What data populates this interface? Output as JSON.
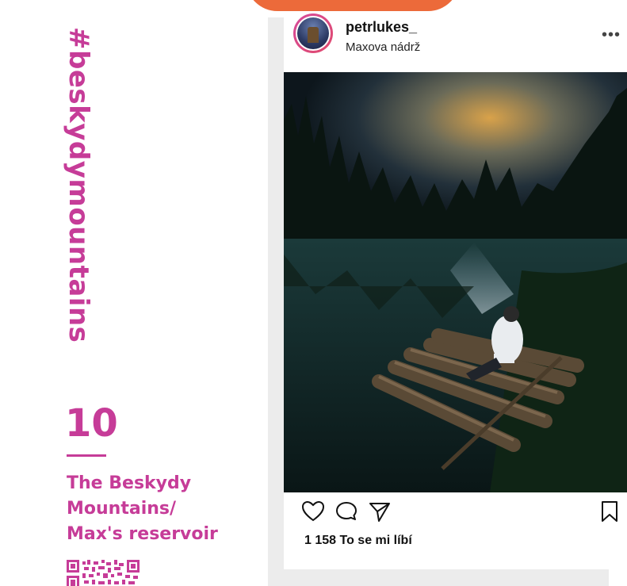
{
  "left_panel": {
    "hashtag": "#beskydymountains",
    "number": "10",
    "title_line1": "The Beskydy",
    "title_line2": "Mountains/",
    "title_line3": "Max's reservoir"
  },
  "post": {
    "username": "petrlukes_",
    "location": "Maxova nádrž",
    "more_label": "•••",
    "likes": "1 158 To se mi líbí"
  },
  "icons": {
    "like": "heart-icon",
    "comment": "comment-icon",
    "share": "send-icon",
    "save": "bookmark-icon",
    "more": "more-dots-icon",
    "qr": "qr-code-icon"
  },
  "colors": {
    "accent": "#c63c98",
    "top_blob": "#ec6a3a"
  }
}
